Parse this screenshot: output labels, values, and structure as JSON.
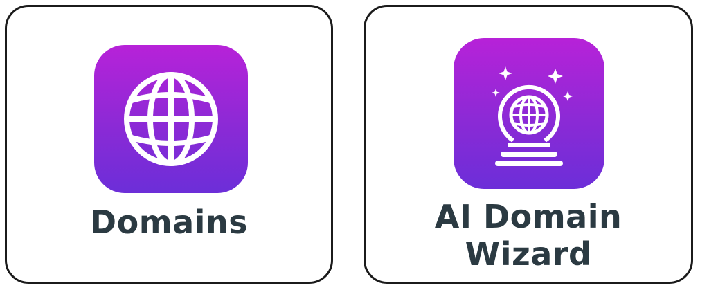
{
  "cards": [
    {
      "label": "Domains",
      "icon": "globe-icon"
    },
    {
      "label_line1": "AI Domain",
      "label_line2": "Wizard",
      "icon": "crystal-ball-globe-icon"
    }
  ],
  "colors": {
    "icon_gradient_top": "#b722d8",
    "icon_gradient_bottom": "#6c2ed8",
    "label_text": "#2b3a42",
    "card_border": "#1b1b1b"
  }
}
